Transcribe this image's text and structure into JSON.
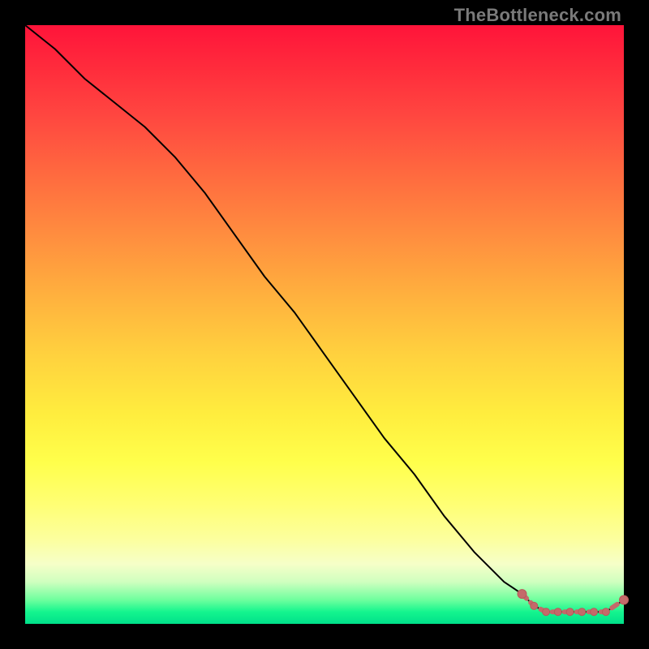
{
  "watermark": {
    "text": "TheBottleneck.com"
  },
  "colors": {
    "line": "#000000",
    "marker_fill": "#c46a6a",
    "marker_stroke": "#b85a5a"
  },
  "chart_data": {
    "type": "line",
    "title": "",
    "xlabel": "",
    "ylabel": "",
    "xlim": [
      0,
      100
    ],
    "ylim": [
      0,
      100
    ],
    "series": [
      {
        "name": "bottleneck-curve",
        "x": [
          0,
          5,
          10,
          15,
          20,
          25,
          30,
          35,
          40,
          45,
          50,
          55,
          60,
          65,
          70,
          75,
          80,
          83,
          85,
          87,
          89,
          91,
          93,
          95,
          97,
          100
        ],
        "y": [
          100,
          96,
          91,
          87,
          83,
          78,
          72,
          65,
          58,
          52,
          45,
          38,
          31,
          25,
          18,
          12,
          7,
          5,
          3,
          2,
          2,
          2,
          2,
          2,
          2,
          4
        ]
      }
    ],
    "markers": {
      "name": "highlight-points",
      "x": [
        83,
        85,
        87,
        89,
        91,
        93,
        95,
        97,
        100
      ],
      "y": [
        5,
        3,
        2,
        2,
        2,
        2,
        2,
        2,
        4
      ]
    }
  }
}
